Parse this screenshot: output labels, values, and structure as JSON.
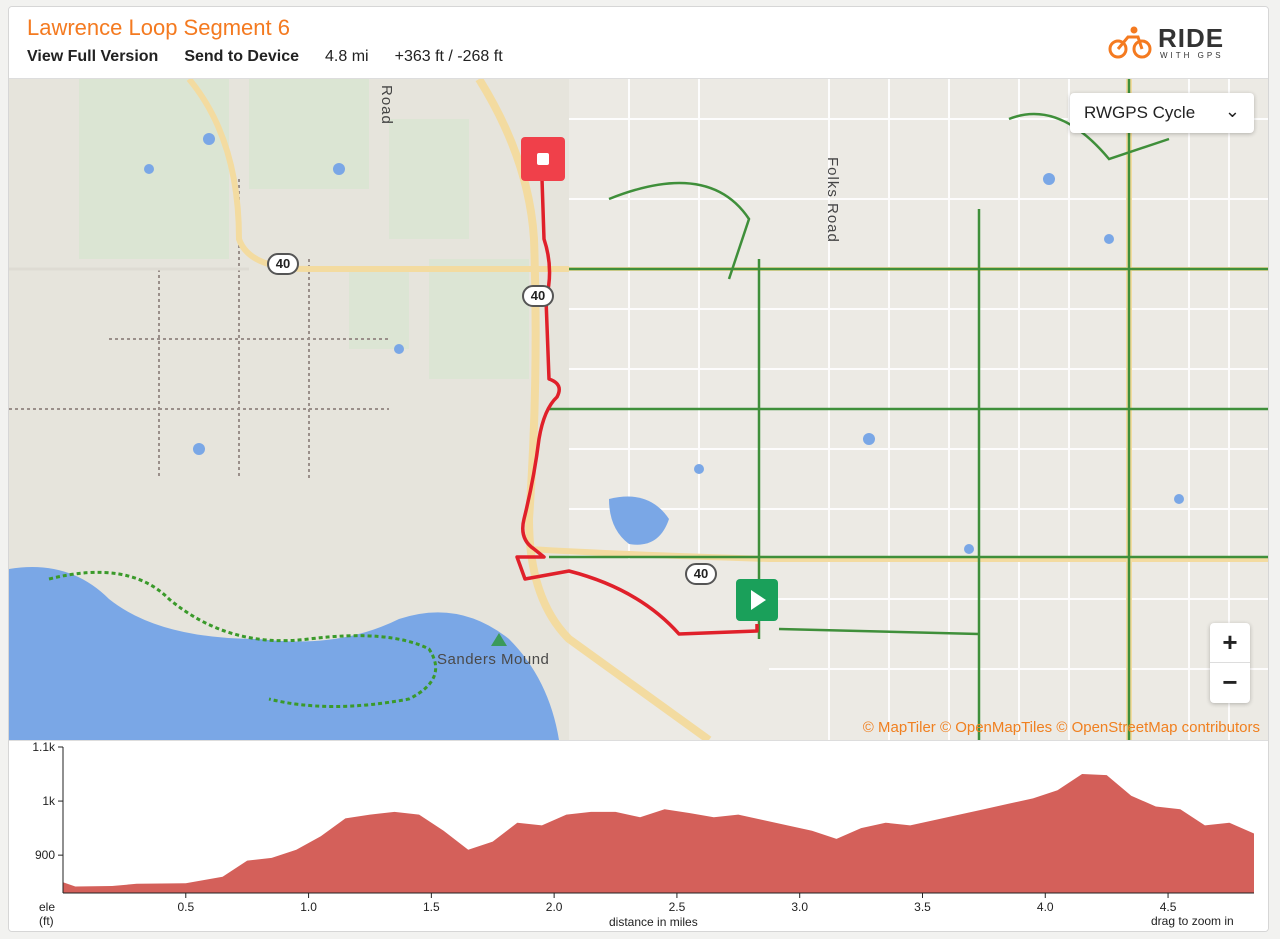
{
  "header": {
    "title": "Lawrence Loop Segment 6",
    "view_full": "View Full Version",
    "send_device": "Send to Device",
    "distance": "4.8 mi",
    "elevation_gain_loss": "+363 ft / -268 ft",
    "logo_word": "RIDE",
    "logo_sub": "WITH GPS"
  },
  "map": {
    "layer_selected": "RWGPS Cycle",
    "zoom_in": "+",
    "zoom_out": "−",
    "attribution": "© MapTiler © OpenMapTiles © OpenStreetMap contributors",
    "road_labels": [
      "Road",
      "Folks Road"
    ],
    "highway_shield": "40",
    "poi": "Sanders Mound",
    "route_color": "#e0202a",
    "start_color": "#1aa05a",
    "end_color": "#f0404a"
  },
  "elevation": {
    "y_label": "ele",
    "y_unit": "(ft)",
    "x_label": "distance in miles",
    "hint": "drag to zoom in",
    "y_ticks": [
      "1.1k",
      "1k",
      "900"
    ],
    "x_ticks": [
      "0.5",
      "1.0",
      "1.5",
      "2.0",
      "2.5",
      "3.0",
      "3.5",
      "4.0",
      "4.5"
    ],
    "fill_color": "#d4605a"
  },
  "chart_data": {
    "type": "area",
    "xlabel": "distance in miles",
    "ylabel": "ele (ft)",
    "xlim": [
      0,
      4.85
    ],
    "ylim": [
      830,
      1100
    ],
    "x": [
      0,
      0.05,
      0.2,
      0.3,
      0.5,
      0.65,
      0.75,
      0.85,
      0.95,
      1.05,
      1.15,
      1.25,
      1.35,
      1.45,
      1.55,
      1.65,
      1.75,
      1.85,
      1.95,
      2.05,
      2.15,
      2.25,
      2.35,
      2.45,
      2.55,
      2.65,
      2.75,
      2.85,
      2.95,
      3.05,
      3.15,
      3.25,
      3.35,
      3.45,
      3.55,
      3.65,
      3.75,
      3.85,
      3.95,
      4.05,
      4.15,
      4.25,
      4.35,
      4.45,
      4.55,
      4.65,
      4.75,
      4.85
    ],
    "y": [
      850,
      842,
      843,
      847,
      848,
      860,
      890,
      895,
      910,
      935,
      968,
      975,
      980,
      975,
      945,
      910,
      925,
      960,
      955,
      975,
      980,
      980,
      970,
      985,
      978,
      970,
      975,
      965,
      955,
      945,
      930,
      950,
      960,
      955,
      965,
      975,
      985,
      995,
      1005,
      1020,
      1050,
      1048,
      1010,
      990,
      985,
      955,
      960,
      940
    ]
  }
}
